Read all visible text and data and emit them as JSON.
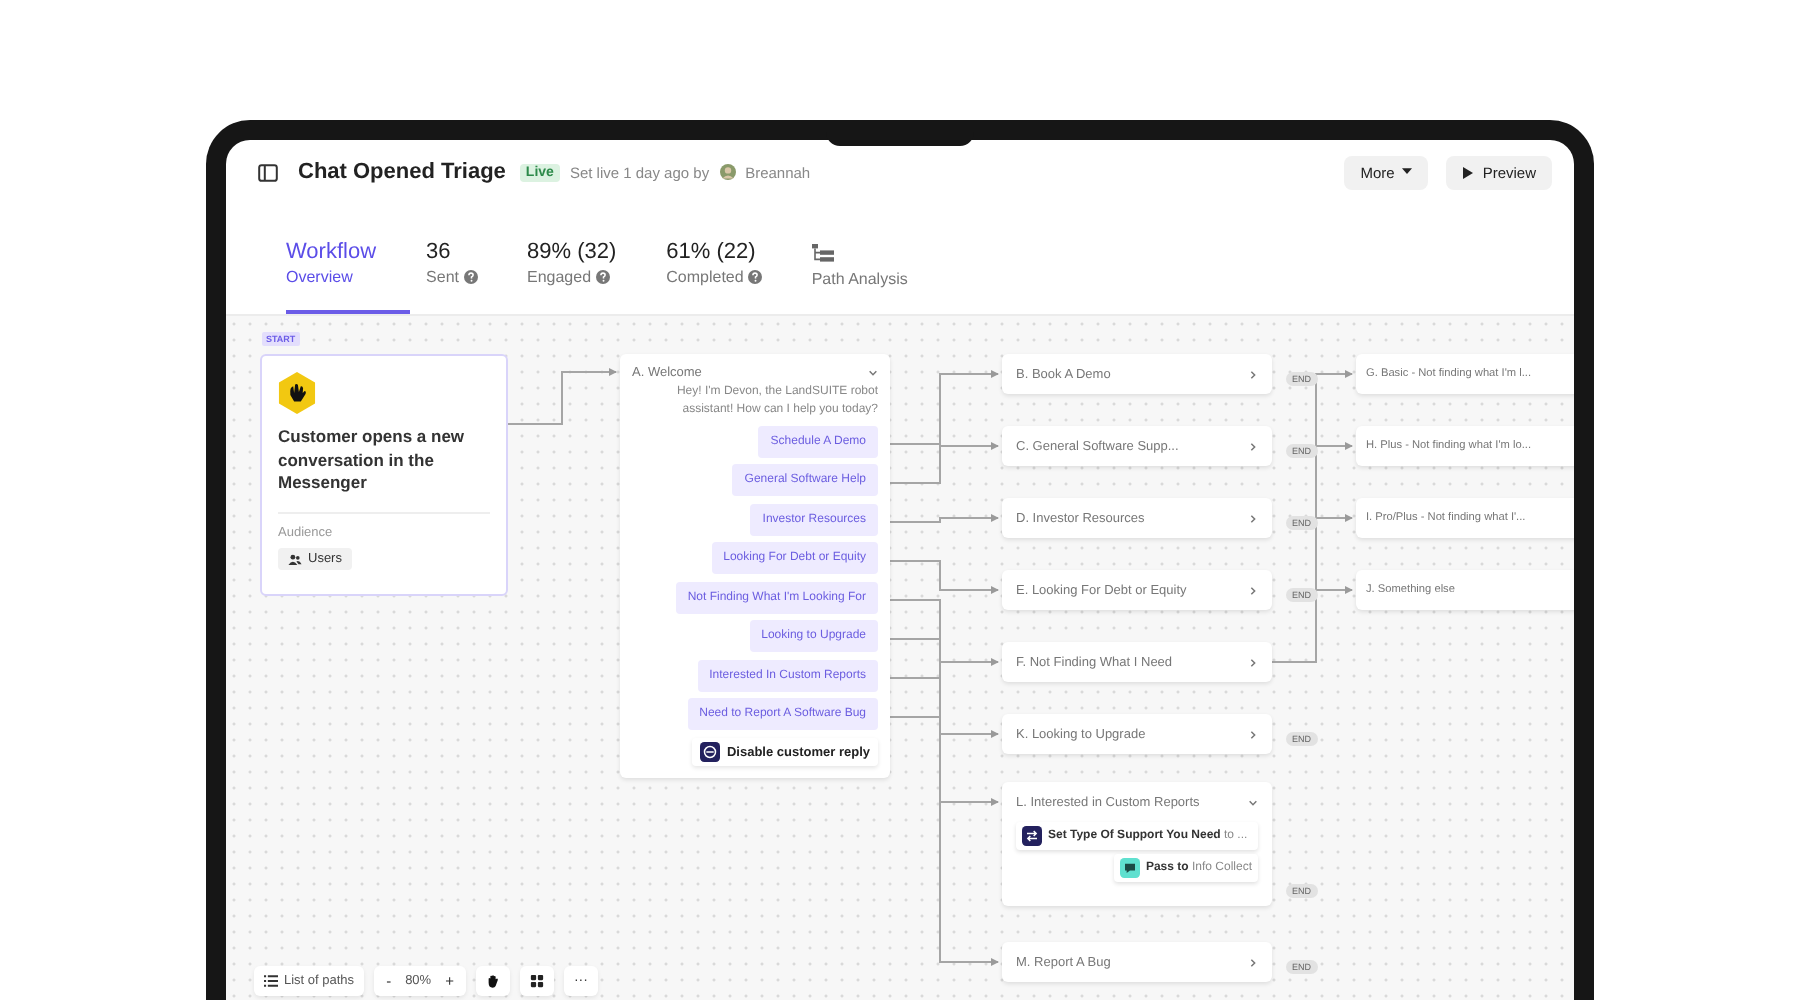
{
  "header": {
    "title": "Chat Opened Triage",
    "status": "Live",
    "set_live": "Set live 1 day ago by",
    "author": "Breannah",
    "buttons": [
      {
        "label": "More",
        "kind": "dropdown"
      },
      {
        "label": "Preview",
        "kind": "play"
      }
    ]
  },
  "tabs": [
    {
      "kind": "text",
      "value": "Workflow",
      "label": "Overview",
      "selected": true
    },
    {
      "kind": "stat",
      "value": "36",
      "label": "Sent",
      "selected": false
    },
    {
      "kind": "stat",
      "value": "89% (32)",
      "label": "Engaged",
      "selected": false
    },
    {
      "kind": "stat",
      "value": "61% (22)",
      "label": "Completed",
      "selected": false
    },
    {
      "kind": "icon",
      "label": "Path Analysis",
      "selected": false
    }
  ],
  "canvas": {
    "start": {
      "badge": "START",
      "trigger": "Customer opens a new conversation in the Messenger",
      "audience_label": "Audience",
      "audience": "Users"
    },
    "welcome": {
      "title": "A. Welcome",
      "expanded": true,
      "message": "Hey! I'm Devon, the LandSUITE robot assistant! How can I help you today?",
      "replies": [
        "Schedule A Demo",
        "General Software Help",
        "Investor Resources",
        "Looking For Debt or Equity",
        "Not Finding What I'm Looking For",
        "Looking to Upgrade",
        "Interested In Custom Reports",
        "Need to Report A Software Bug"
      ],
      "action": "Disable customer reply"
    },
    "paths": [
      {
        "title": "B. Book A Demo",
        "expanded": false,
        "end": "END"
      },
      {
        "title": "C. General Software Supp...",
        "expanded": false,
        "end": "END"
      },
      {
        "title": "D. Investor Resources",
        "expanded": false,
        "end": "END"
      },
      {
        "title": "E. Looking For Debt or Equity",
        "expanded": false,
        "end": "END"
      },
      {
        "title": "F. Not Finding What I Need",
        "expanded": false,
        "children": [
          {
            "title": "G. Basic - Not finding what I'm l..."
          },
          {
            "title": "H. Plus - Not finding what I'm lo..."
          },
          {
            "title": "I. Pro/Plus - Not finding what I'..."
          },
          {
            "title": "J. Something else"
          }
        ]
      },
      {
        "title": "K. Looking to Upgrade",
        "expanded": false,
        "end": "END"
      },
      {
        "title": "L. Interested in Custom Reports",
        "expanded": true,
        "end": "END",
        "steps": [
          {
            "kind": "set",
            "text": "**Set Type Of Support You Need** to ..."
          },
          {
            "kind": "pass",
            "text": "**Pass to** Info Collect"
          }
        ]
      },
      {
        "title": "M. Report A Bug",
        "expanded": false,
        "end": "END"
      }
    ]
  },
  "toolbar": {
    "list": "List of paths",
    "minus": "-",
    "zoom": "80%",
    "plus": "+",
    "more": "···"
  }
}
